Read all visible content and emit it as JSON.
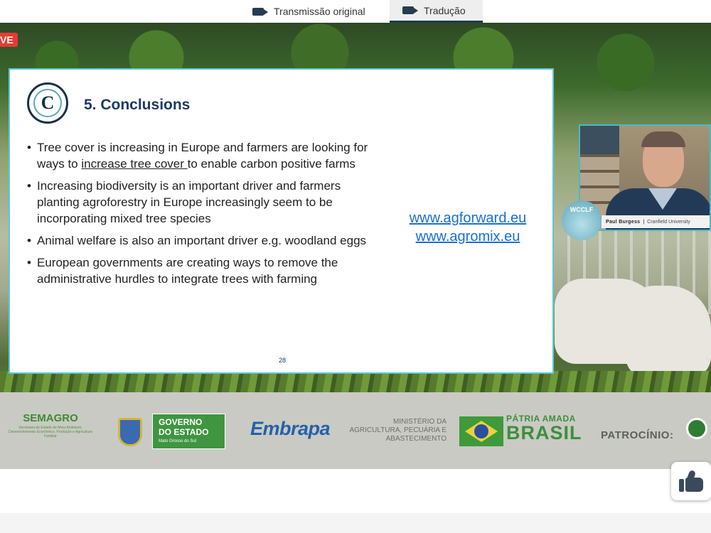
{
  "tabs": [
    {
      "label": "Transmissão original",
      "icon": "video-camera-icon",
      "active": false
    },
    {
      "label": "Tradução",
      "icon": "video-camera-icon",
      "active": true
    }
  ],
  "live_badge": "VE",
  "slide": {
    "title": "5. Conclusions",
    "bullets": [
      {
        "before": "Tree cover is increasing in Europe and farmers are looking for ways to ",
        "underlined": "increase tree cover ",
        "after": "to enable carbon positive farms"
      },
      {
        "text": "Increasing biodiversity is an important driver and farmers planting agroforestry in Europe increasingly seem to be incorporating mixed tree species"
      },
      {
        "text": "Animal welfare is also an important driver e.g. woodland eggs"
      },
      {
        "text": "European governments are creating ways to remove the administrative hurdles to integrate trees with farming"
      }
    ],
    "links": [
      "www.agforward.eu",
      "www.agromix.eu"
    ],
    "page_number": "28",
    "logo_letter": "C"
  },
  "speaker": {
    "name": "Paul Burgess",
    "separator": "|",
    "organization": "Cranfield University"
  },
  "event_logo_text": "WCCLF",
  "sponsors": {
    "semagro": {
      "name": "SEMAGRO",
      "desc": "Secretaria de Estado de Meio Ambiente, Desenvolvimento Econômico, Produção e Agricultura Familiar"
    },
    "governo": {
      "line1": "GOVERNO",
      "line2": "DO ESTADO",
      "line3": "Mato Grosso do Sul"
    },
    "embrapa": "Embrapa",
    "ministerio": "MINISTÉRIO DA AGRICULTURA, PECUÁRIA E ABASTECIMENTO",
    "patria": {
      "line1": "PÁTRIA AMADA",
      "line2": "BRASIL"
    },
    "patrocinio": "PATROCÍNIO:"
  },
  "colors": {
    "accent": "#5cc8d3",
    "title": "#1c3b63",
    "link": "#1a6fd4",
    "live": "#e53b34"
  }
}
